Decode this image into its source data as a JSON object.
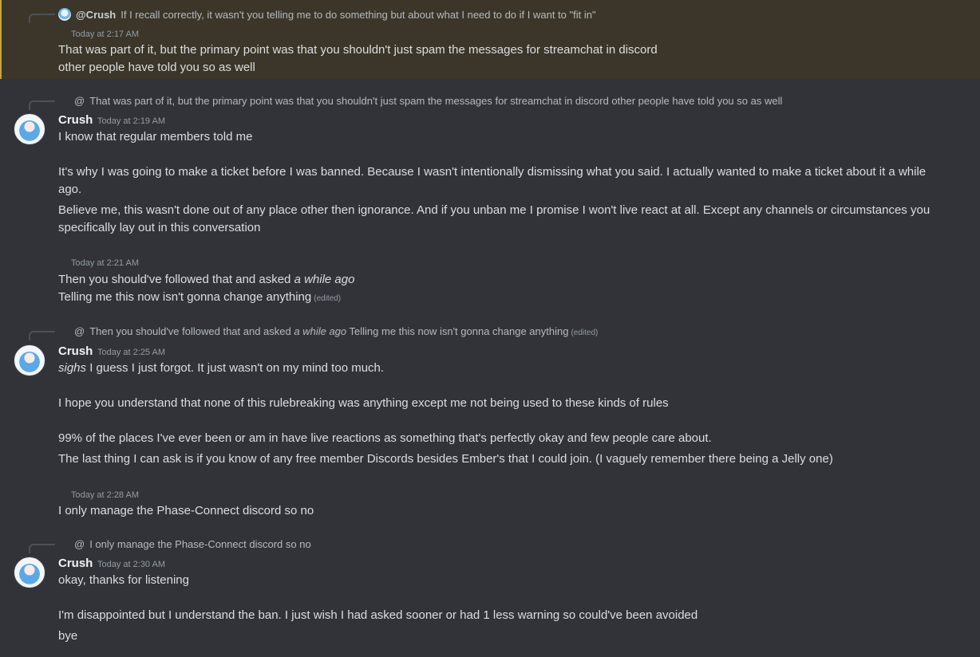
{
  "block1": {
    "reply_name": "@Crush",
    "reply_text": "If I recall correctly, it wasn't you telling me to do something but about what I need to do if I want to \"fit in\"",
    "timestamp": "Today at 2:17 AM",
    "line1": "That was part of it, but the primary point was that you shouldn't just spam the messages for streamchat in discord",
    "line2": "other people have told you so as well"
  },
  "block2": {
    "reply_at": "@",
    "reply_text": "That was part of it, but the primary point was that you shouldn't just spam the messages for streamchat in discord other people have told you so as well",
    "username": "Crush",
    "timestamp": "Today at 2:19 AM",
    "line1": "I know that regular members told me",
    "line2": "It's why I was going to make a ticket before I was banned. Because I wasn't intentionally dismissing what you said. I actually wanted to make a ticket about it a while ago.",
    "line3": "Believe me, this wasn't done out of any place other then ignorance. And if you unban me I promise I won't live react at all. Except any channels or circumstances you specifically lay out in this conversation"
  },
  "block3": {
    "timestamp": "Today at 2:21 AM",
    "line1_a": "Then you should've followed that and asked ",
    "line1_em": "a while ago",
    "line2": "Telling me this now isn't gonna change anything",
    "edited": "(edited)"
  },
  "block4": {
    "reply_at": "@",
    "reply_text_a": "Then you should've followed that and asked ",
    "reply_text_em": "a while ago",
    "reply_text_b": " Telling me this now isn't gonna change anything",
    "reply_edited": "(edited)",
    "username": "Crush",
    "timestamp": "Today at 2:25 AM",
    "line1_em": "sighs",
    "line1_b": " I guess I just forgot. It just wasn't on my mind too much.",
    "line2": "I hope you understand that none of this rulebreaking was anything except me not being used to these kinds of rules",
    "line3": "99% of the places I've ever been or am in have live reactions as something that's perfectly okay and few people care about.",
    "line4": "The last thing I can ask is if you know of any free member Discords besides Ember's that I could join. (I vaguely remember there being a Jelly one)"
  },
  "block5": {
    "timestamp": "Today at 2:28 AM",
    "line1": "I only manage the Phase-Connect discord so no"
  },
  "block6": {
    "reply_at": "@",
    "reply_text": "I only manage the Phase-Connect discord so no",
    "username": "Crush",
    "timestamp": "Today at 2:30 AM",
    "line1": "okay, thanks for listening",
    "line2": "I'm disappointed but I understand the ban. I just wish I had asked sooner or had 1 less warning so could've been avoided",
    "line3": "bye"
  }
}
